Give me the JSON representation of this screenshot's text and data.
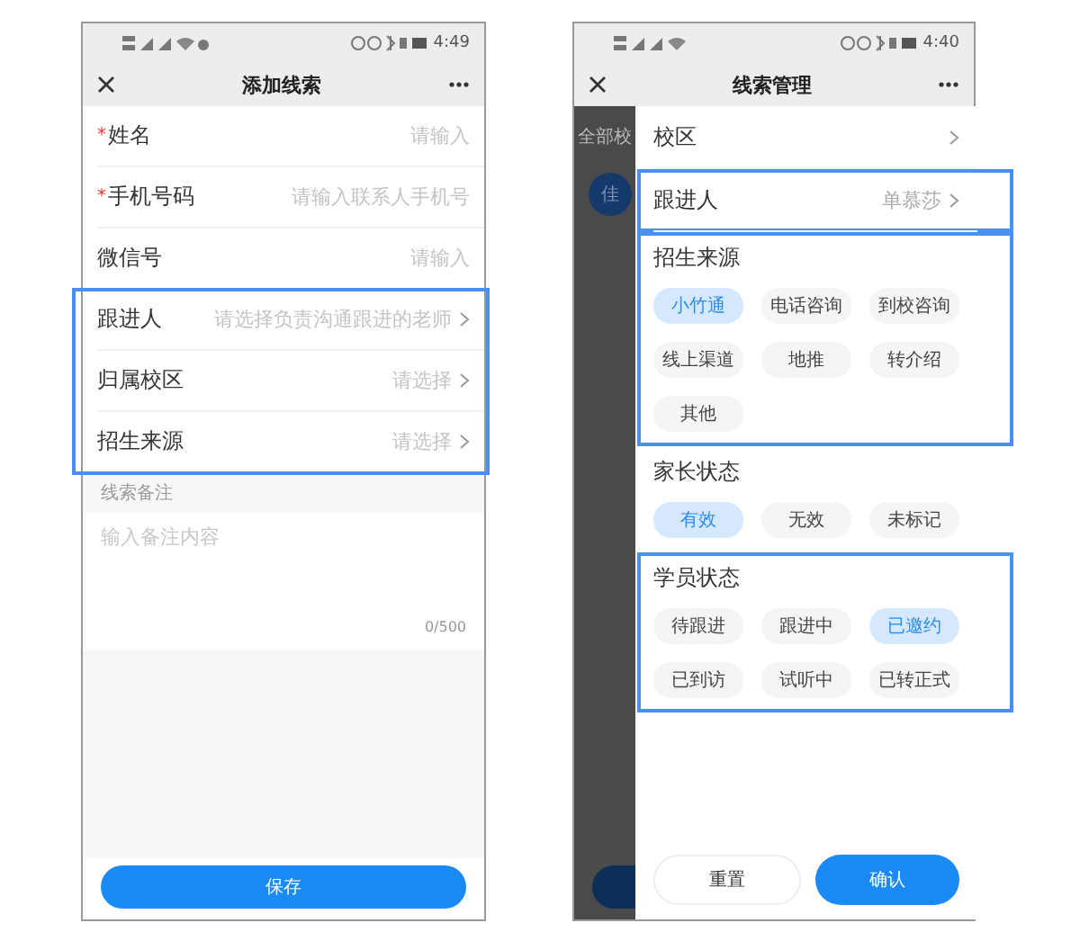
{
  "left_screen": {
    "status_bar": {
      "time": "4:49"
    },
    "title": "添加线索",
    "field_groups": [
      {
        "highlighted": false,
        "fields": [
          {
            "label": "姓名",
            "required_mark": "*",
            "placeholder": "请输入",
            "kind": "input"
          },
          {
            "label": "手机号码",
            "required_mark": "*",
            "placeholder": "请输入联系人手机号",
            "kind": "input"
          },
          {
            "label": "微信号",
            "placeholder": "请输入",
            "kind": "input"
          }
        ]
      },
      {
        "highlighted": true,
        "fields": [
          {
            "label": "跟进人",
            "placeholder": "请选择负责沟通跟进的老师",
            "kind": "select"
          },
          {
            "label": "归属校区",
            "placeholder": "请选择",
            "kind": "select"
          },
          {
            "label": "招生来源",
            "placeholder": "请选择",
            "kind": "select"
          }
        ]
      }
    ],
    "remark": {
      "header": "线索备注",
      "placeholder": "输入备注内容",
      "counter": "0/500"
    },
    "save_button": "保存"
  },
  "right_screen": {
    "status_bar": {
      "time": "4:40"
    },
    "title": "线索管理",
    "background": {
      "tab": "全部校",
      "avatar": "佳"
    },
    "rows": [
      {
        "label": "校区",
        "highlighted": false
      },
      {
        "label": "跟进人",
        "value": "单慕莎",
        "highlighted": true
      }
    ],
    "groups": [
      {
        "title": "招生来源",
        "highlighted": true,
        "options": [
          {
            "label": "小竹通",
            "selected": true
          },
          {
            "label": "电话咨询",
            "selected": false
          },
          {
            "label": "到校咨询",
            "selected": false
          },
          {
            "label": "线上渠道",
            "selected": false
          },
          {
            "label": "地推",
            "selected": false
          },
          {
            "label": "转介绍",
            "selected": false
          },
          {
            "label": "其他",
            "selected": false
          }
        ]
      },
      {
        "title": "家长状态",
        "highlighted": false,
        "options": [
          {
            "label": "有效",
            "selected": true
          },
          {
            "label": "无效",
            "selected": false
          },
          {
            "label": "未标记",
            "selected": false
          }
        ]
      },
      {
        "title": "学员状态",
        "highlighted": true,
        "options": [
          {
            "label": "待跟进",
            "selected": false
          },
          {
            "label": "跟进中",
            "selected": false
          },
          {
            "label": "已邀约",
            "selected": true
          },
          {
            "label": "已到访",
            "selected": false
          },
          {
            "label": "试听中",
            "selected": false
          },
          {
            "label": "已转正式",
            "selected": false
          }
        ]
      }
    ],
    "buttons": {
      "reset": "重置",
      "confirm": "确认"
    }
  }
}
